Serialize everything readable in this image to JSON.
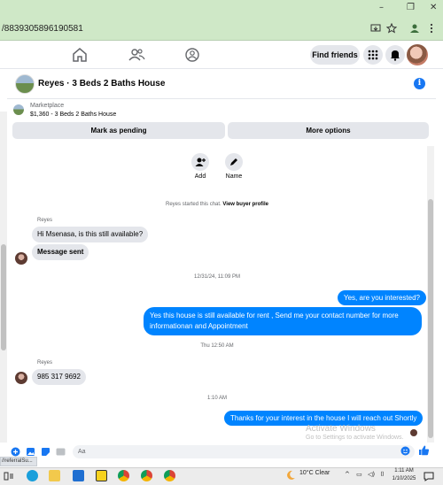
{
  "browser": {
    "url_fragment": "/8839305896190581",
    "minimize_glyph": "–",
    "restore_glyph": "❐",
    "close_glyph": "✕"
  },
  "nav": {
    "find_friends_label": "Find friends"
  },
  "chat": {
    "title": "Reyes · 3 Beds 2 Baths House",
    "info_glyph": "i",
    "marketplace_label": "Marketplace",
    "listing": "$1,360 - 3 Beds 2 Baths House",
    "mark_pending_label": "Mark as pending",
    "more_options_label": "More options",
    "add_label": "Add",
    "name_label": "Name",
    "started_text": "Reyes started this chat.",
    "view_profile_link": "View buyer profile"
  },
  "messages": {
    "sender1": "Reyes",
    "in1": "Hi Msenasa, is this still available?",
    "in2": "Message sent",
    "ts1": "12/31/24, 11:09 PM",
    "out1": "Yes, are you interested?",
    "out2_line1": "Yes this house is still available for rent , Send me your contact number for more",
    "out2_line2": "informationan and Appointment",
    "ts2": "Thu 12:50 AM",
    "sender2": "Reyes",
    "in3": "985 317 9692",
    "ts3": "1:10 AM",
    "out3": "Thanks for your interest in the house I will reach out Shortly"
  },
  "watermark": {
    "line1": "Activate Windows",
    "line2": "Go to Settings to activate Windows."
  },
  "composer": {
    "placeholder": "Aa"
  },
  "status_bar": {
    "url": "//referralSu..."
  },
  "taskbar": {
    "weather": "10°C  Clear",
    "time": "1:11 AM",
    "date": "1/10/2025"
  },
  "colors": {
    "accent": "#1877f2",
    "outgoing_bubble": "#0084ff",
    "incoming_bubble": "#e4e6eb"
  }
}
